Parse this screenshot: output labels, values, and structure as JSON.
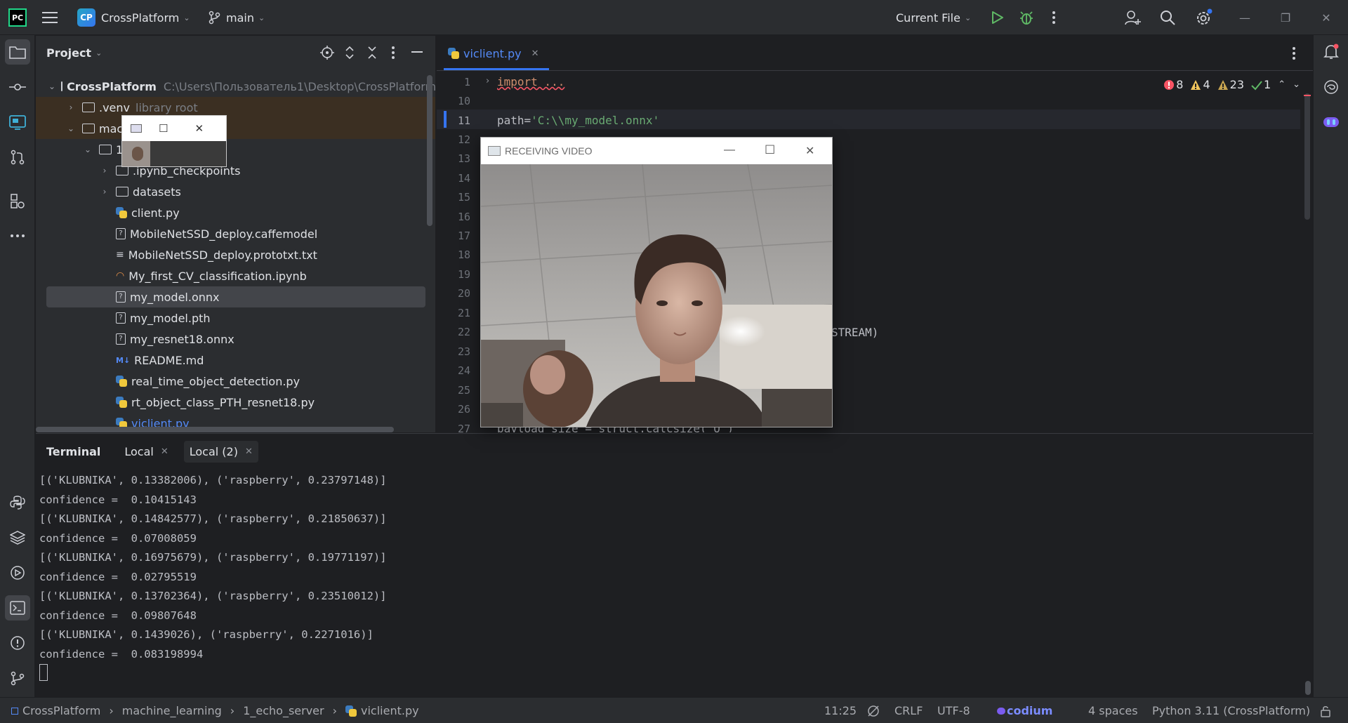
{
  "titlebar": {
    "project_badge": "CP",
    "project_name": "CrossPlatform",
    "branch": "main",
    "run_config": "Current File",
    "icons": [
      "hamburger-icon",
      "branch-icon",
      "run-icon",
      "debug-icon",
      "more-icon",
      "add-user-icon",
      "search-icon",
      "settings-icon",
      "minimize-icon",
      "restore-icon",
      "close-icon"
    ]
  },
  "project_panel": {
    "title": "Project",
    "root_name": "CrossPlatform",
    "root_path": "C:\\Users\\Пользователь1\\Desktop\\CrossPlatform",
    "venv_name": ".venv",
    "venv_hint": "library root",
    "folder_mac": "mac",
    "folder_1": "1",
    "items": [
      ".ipynb_checkpoints",
      "datasets",
      "client.py",
      "MobileNetSSD_deploy.caffemodel",
      "MobileNetSSD_deploy.prototxt.txt",
      "My_first_CV_classification.ipynb",
      "my_model.onnx",
      "my_model.pth",
      "my_resnet18.onnx",
      "README.md",
      "real_time_object_detection.py",
      "rt_object_class_PTH_resnet18.py",
      "viclient.py"
    ],
    "selected": "my_model.onnx"
  },
  "editor": {
    "tab_name": "viclient.py",
    "inspections": {
      "errors": "8",
      "warnings": "4",
      "weak_warnings": "23",
      "ok": "1"
    },
    "line_numbers": [
      "1",
      "10",
      "11",
      "12",
      "13",
      "14",
      "15",
      "16",
      "17",
      "18",
      "19",
      "20",
      "21",
      "22",
      "23",
      "24",
      "25",
      "26",
      "27"
    ],
    "line1": "import ...",
    "line11_prefix": "path=",
    "line11_string": "'C:\\\\my_model.onnx'",
    "line22_visible": "STREAM)",
    "line27": "payload_size = struct.calcsize(\"Q\")"
  },
  "video_window": {
    "title": "RECEIVING VIDEO"
  },
  "terminal": {
    "title": "Terminal",
    "tabs": [
      "Local",
      "Local (2)"
    ],
    "lines": [
      "[('KLUBNIKA', 0.13382006), ('raspberry', 0.23797148)]",
      "confidence =  0.10415143",
      "[('KLUBNIKA', 0.14842577), ('raspberry', 0.21850637)]",
      "confidence =  0.07008059",
      "[('KLUBNIKA', 0.16975679), ('raspberry', 0.19771197)]",
      "confidence =  0.02795519",
      "[('KLUBNIKA', 0.13702364), ('raspberry', 0.23510012)]",
      "confidence =  0.09807648",
      "[('KLUBNIKA', 0.1439026), ('raspberry', 0.2271016)]",
      "confidence =  0.083198994"
    ]
  },
  "statusbar": {
    "breadcrumb": [
      "CrossPlatform",
      "machine_learning",
      "1_echo_server",
      "viclient.py"
    ],
    "position": "11:25",
    "line_ending": "CRLF",
    "encoding": "UTF-8",
    "codium": "codium",
    "indent": "4 spaces",
    "interpreter": "Python 3.11 (CrossPlatform)"
  },
  "colors": {
    "accent": "#3574f0",
    "error": "#f75464",
    "warning": "#f2c55c",
    "ok": "#5fb865",
    "string": "#6aab73"
  }
}
